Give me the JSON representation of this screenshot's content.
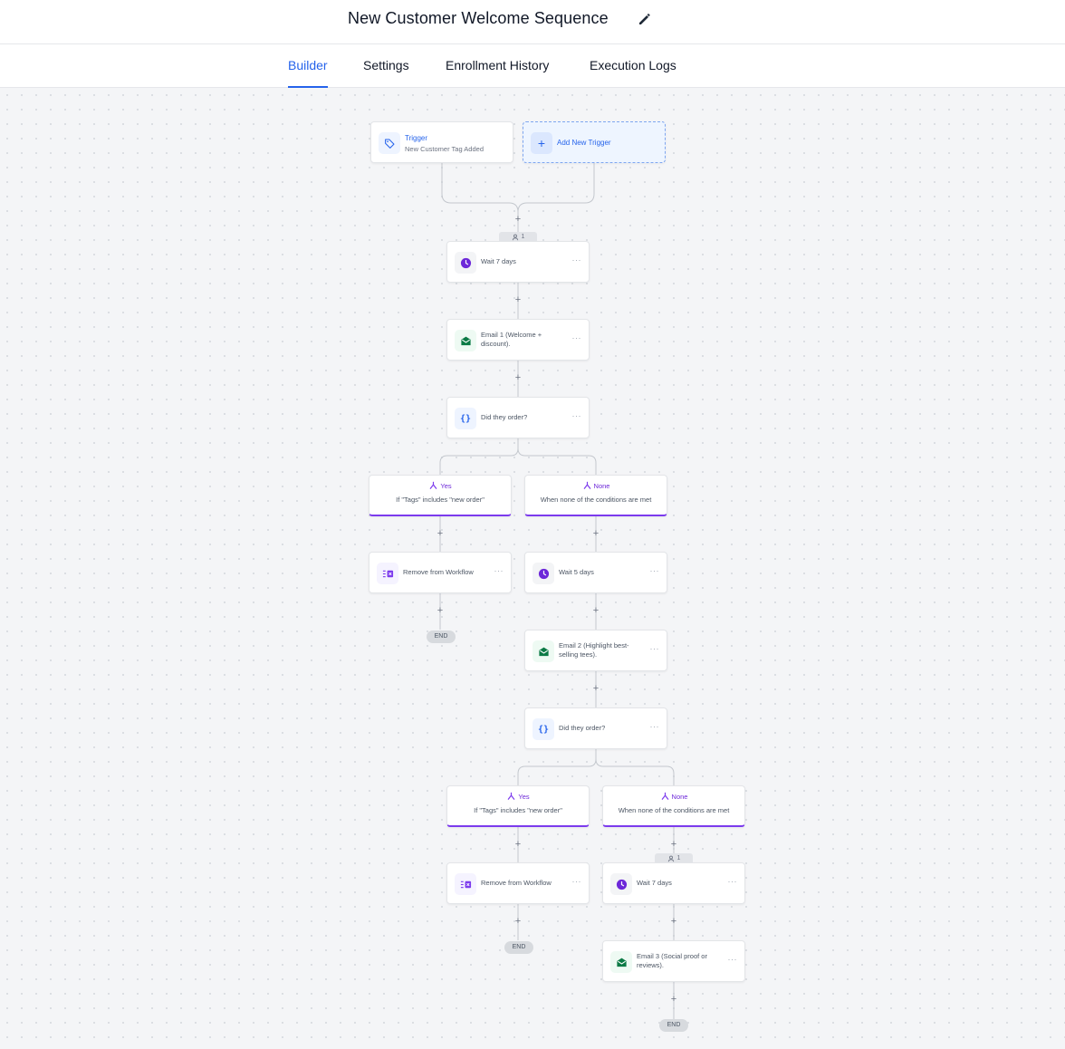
{
  "header": {
    "title": "New Customer Welcome Sequence",
    "edit_icon": "pencil-icon"
  },
  "tabs": [
    {
      "label": "Builder",
      "active": true
    },
    {
      "label": "Settings",
      "active": false
    },
    {
      "label": "Enrollment History",
      "active": false
    },
    {
      "label": "Execution Logs",
      "active": false
    }
  ],
  "workflow": {
    "trigger": {
      "title": "Trigger",
      "subtitle": "New Customer Tag Added",
      "icon": "tag-icon"
    },
    "add_trigger": {
      "label": "Add New Trigger",
      "icon": "plus-icon"
    },
    "enrollment_count_1": "1",
    "enrollment_count_2": "1",
    "step_wait_1": "Wait 7 days",
    "step_email_1": "Email 1 (Welcome + discount).",
    "step_condition_1": "Did they order?",
    "branch_yes_1": {
      "label": "Yes",
      "condition": "If \"Tags\" includes \"new order\""
    },
    "branch_none_1": {
      "label": "None",
      "condition": "When none of the conditions are met"
    },
    "step_remove_1": "Remove from Workflow",
    "step_wait_2": "Wait 5 days",
    "step_email_2": "Email 2 (Highlight best-selling tees).",
    "step_condition_2": "Did they order?",
    "branch_yes_2": {
      "label": "Yes",
      "condition": "If \"Tags\" includes \"new order\""
    },
    "branch_none_2": {
      "label": "None",
      "condition": "When none of the conditions are met"
    },
    "step_remove_2": "Remove from Workflow",
    "step_wait_3": "Wait 7 days",
    "step_email_3": "Email 3 (Social proof or reviews).",
    "end_label": "END",
    "more_label": "···",
    "add_step_label": "+"
  },
  "colors": {
    "accent": "#2563eb",
    "branch": "#7c3aed",
    "wait_icon": "#6d28d9",
    "email_icon": "#0b7a45"
  }
}
